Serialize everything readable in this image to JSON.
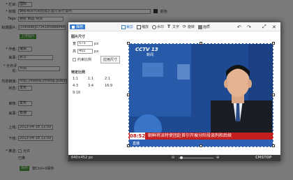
{
  "bg": {
    "row1": {
      "label": "* 栏目:",
      "value": "国际"
    },
    "row2": {
      "label": "* 标题:",
      "value": "朝鲜特派代表团抵达首尔进行谈判",
      "check": "颜色"
    },
    "row3": {
      "label": "Tags:",
      "value": "朝鲜 韩国 特派"
    },
    "row4": {
      "label": "标题图片:",
      "value": "[chinese]073416f0eb6f4c06"
    },
    "row5": {
      "label": "",
      "value": "上传图片"
    },
    "row6": {
      "label": "* 作者:",
      "value": "编辑"
    },
    "row7": {
      "label": "来源:",
      "value": "新华"
    },
    "row8": {
      "label": "发布时间:",
      "value": ""
    },
    "row9": {
      "label": "* 允许评论:",
      "value": "开启"
    },
    "row10": {
      "label": "内容链接:",
      "value": "http://media.cmstop.pub/pic/2"
    },
    "row11": {
      "label": "状态:",
      "value": "发布"
    },
    "row12": {
      "label": "审核:",
      "value": "发布"
    },
    "row13": {
      "label": "来源:",
      "value": "普通"
    },
    "row14": {
      "label": "上线:",
      "value": "2013-04-18 11:09"
    },
    "row15": {
      "label": "下线:",
      "value": "2013-04-18 11:09"
    },
    "row16": {
      "label": "* 推送:",
      "value": "允许"
    },
    "row17": {
      "label": "",
      "value": "已推"
    },
    "submit": "保存",
    "hint": "按Ctrl+S保存"
  },
  "modal": {
    "save": "保存",
    "tools": [
      "裁剪",
      "缩放",
      "水印",
      "文字",
      "旋转",
      "画质"
    ],
    "dims_title": "图片尺寸",
    "width_label": "宽",
    "width_value": "573",
    "height_label": "高",
    "height_value": "402",
    "unit": "px",
    "lock_label": "约束比例",
    "apply_btn": "应用尺寸",
    "ratio_title": "特定比例",
    "ratios": [
      "1:1",
      "1:1",
      "2:1",
      "4:3",
      "3:4",
      "16:9",
      "9:16"
    ],
    "status": "640×452 px",
    "zoom_label": "100%",
    "brand": "CMSTOP",
    "logo": "CCTV 13",
    "logo_sub": "新闻",
    "time": "08:52",
    "ticker": "朝鲜将派特使团赴首尔开展分阶段谈判和后续",
    "channel_badge": "直播"
  },
  "colors": {
    "accent": "#3b7ed0",
    "bar": "#c31f1f",
    "green": "#4a9a3a"
  }
}
